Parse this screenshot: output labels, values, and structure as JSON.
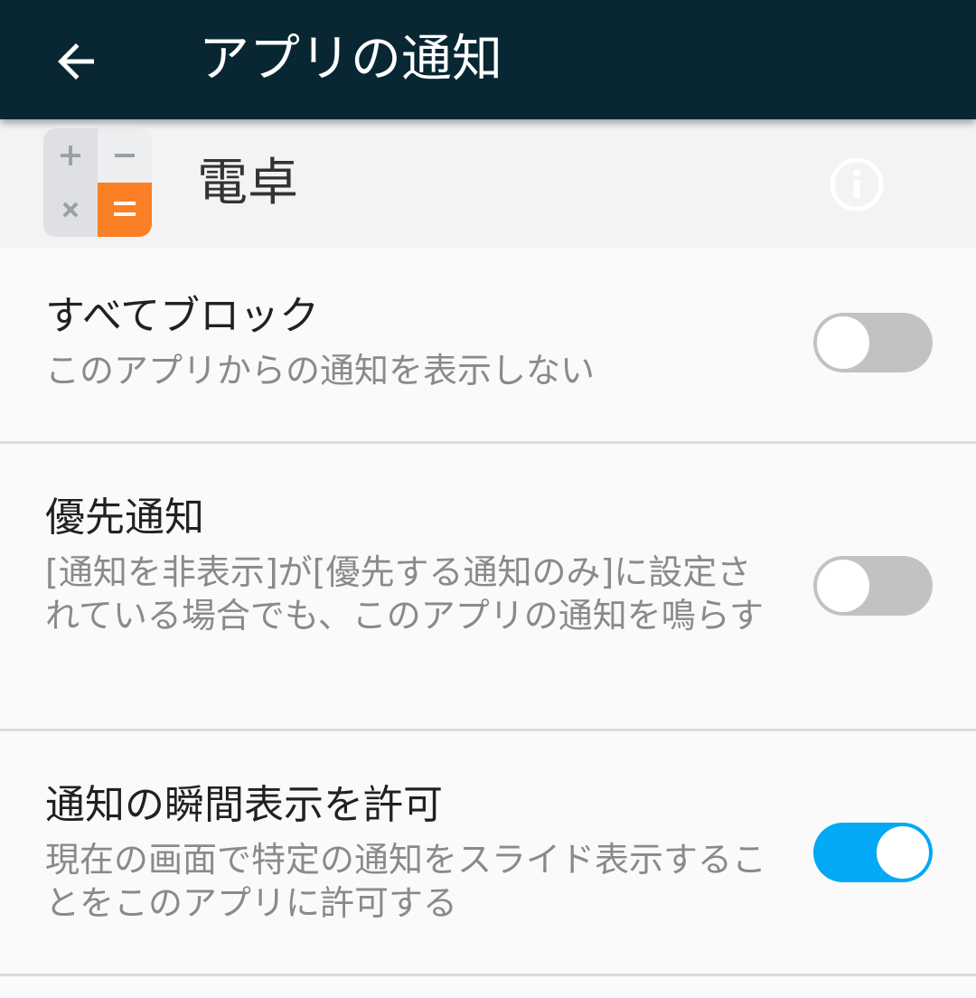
{
  "toolbar": {
    "title": "アプリの通知",
    "back_icon": "arrow-left-icon"
  },
  "app": {
    "name": "電卓",
    "icon": "calculator-icon",
    "info_icon": "info-icon"
  },
  "settings": [
    {
      "title": "すべてブロック",
      "description": "このアプリからの通知を表示しない",
      "enabled": false
    },
    {
      "title": "優先通知",
      "description": "[通知を非表示]が[優先する通知のみ]に設定されている場合でも、このアプリの通知を鳴らす",
      "enabled": false
    },
    {
      "title": "通知の瞬間表示を許可",
      "description": "現在の画面で特定の通知をスライド表示することをこのアプリに許可する",
      "enabled": true
    }
  ],
  "colors": {
    "app_bar": "#092733",
    "switch_on": "#03a9f4",
    "switch_off": "#c2c2c2",
    "calculator_accent": "#fb7f24"
  }
}
